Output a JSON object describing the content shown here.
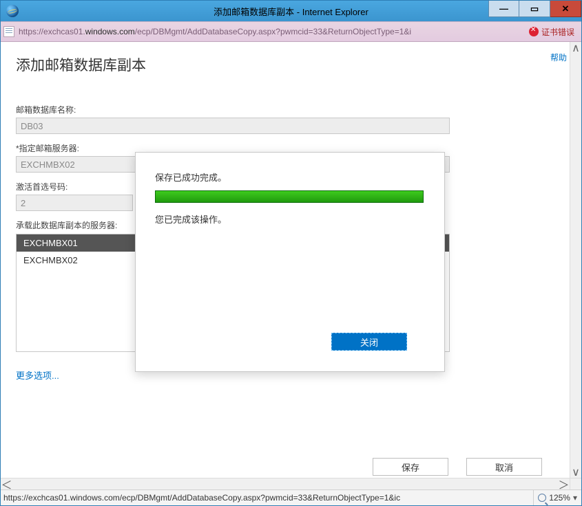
{
  "window": {
    "title": "添加邮箱数据库副本 - Internet Explorer"
  },
  "address_bar": {
    "scheme": "https://",
    "host_pre": "exchcas01.",
    "host_bold": "windows.com",
    "path": "/ecp/DBMgmt/AddDatabaseCopy.aspx?pwmcid=33&ReturnObjectType=1&i",
    "cert_error_label": "证书错误"
  },
  "page": {
    "help_link": "帮助",
    "title": "添加邮箱数据库副本",
    "db_name_label": "邮箱数据库名称:",
    "db_name_value": "DB03",
    "server_label": "*指定邮箱服务器:",
    "server_value": "EXCHMBX02",
    "activation_label": "激活首选号码:",
    "activation_value": "2",
    "hosts_label": "承载此数据库副本的服务器:",
    "hosts": [
      "EXCHMBX01",
      "EXCHMBX02"
    ],
    "more_options": "更多选项...",
    "save_label": "保存",
    "cancel_label": "取消"
  },
  "modal": {
    "line1": "保存已成功完成。",
    "line2": "您已完成该操作。",
    "close_label": "关闭"
  },
  "status": {
    "url": "https://exchcas01.windows.com/ecp/DBMgmt/AddDatabaseCopy.aspx?pwmcid=33&ReturnObjectType=1&ic",
    "zoom": "125%"
  }
}
